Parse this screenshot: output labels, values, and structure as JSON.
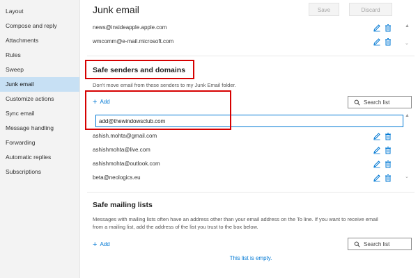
{
  "sidebar": {
    "items": [
      {
        "label": "Layout"
      },
      {
        "label": "Compose and reply"
      },
      {
        "label": "Attachments"
      },
      {
        "label": "Rules"
      },
      {
        "label": "Sweep"
      },
      {
        "label": "Junk email",
        "active": true
      },
      {
        "label": "Customize actions"
      },
      {
        "label": "Sync email"
      },
      {
        "label": "Message handling"
      },
      {
        "label": "Forwarding"
      },
      {
        "label": "Automatic replies"
      },
      {
        "label": "Subscriptions"
      }
    ]
  },
  "header": {
    "title": "Junk email",
    "save_label": "Save",
    "discard_label": "Discard"
  },
  "blocked_list": {
    "items": [
      "news@insideapple.apple.com",
      "wmcomm@e-mail.microsoft.com"
    ]
  },
  "safe_senders": {
    "title": "Safe senders and domains",
    "description": "Don't move email from these senders to my Junk Email folder.",
    "add_label": "Add",
    "search_placeholder": "Search list",
    "input_value": "add@thewindowsclub.com",
    "items": [
      "ashish.mohta@gmail.com",
      "ashishmohta@live.com",
      "ashishmohta@outlook.com",
      "beta@neologics.eu"
    ]
  },
  "safe_mailing": {
    "title": "Safe mailing lists",
    "description_line1": "Messages with mailing lists often have an address other than your email address on the To line. If you want to receive email",
    "description_line2": "from a mailing list, add the address of the list you trust to the box below.",
    "add_label": "Add",
    "search_placeholder": "Search list",
    "empty_message": "This list is empty."
  },
  "colors": {
    "accent": "#0078d4",
    "active_nav": "#c7e0f4",
    "highlight_box": "#d60000"
  }
}
